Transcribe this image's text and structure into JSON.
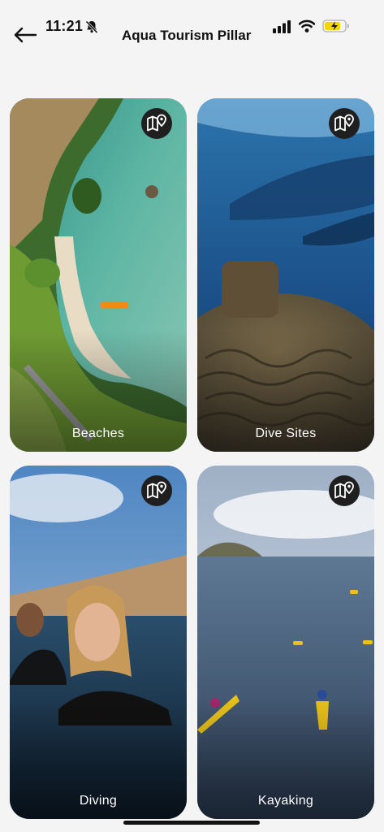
{
  "status_bar": {
    "time": "11:21",
    "icons": [
      "bell-slash-icon",
      "cellular-signal-icon",
      "wifi-icon",
      "battery-charging-icon"
    ],
    "battery_color": "#f5d400"
  },
  "header": {
    "back_icon": "arrow-left-icon",
    "title": "Aqua Tourism Pillar"
  },
  "cards": [
    {
      "label": "Beaches",
      "icon": "map-pin-icon"
    },
    {
      "label": "Dive Sites",
      "icon": "map-pin-icon"
    },
    {
      "label": "Diving",
      "icon": "map-pin-icon"
    },
    {
      "label": "Kayaking",
      "icon": "map-pin-icon"
    }
  ],
  "colors": {
    "background": "#f4f4f4",
    "map_button_bg": "#1f1f1f",
    "label_text": "#ffffff"
  }
}
